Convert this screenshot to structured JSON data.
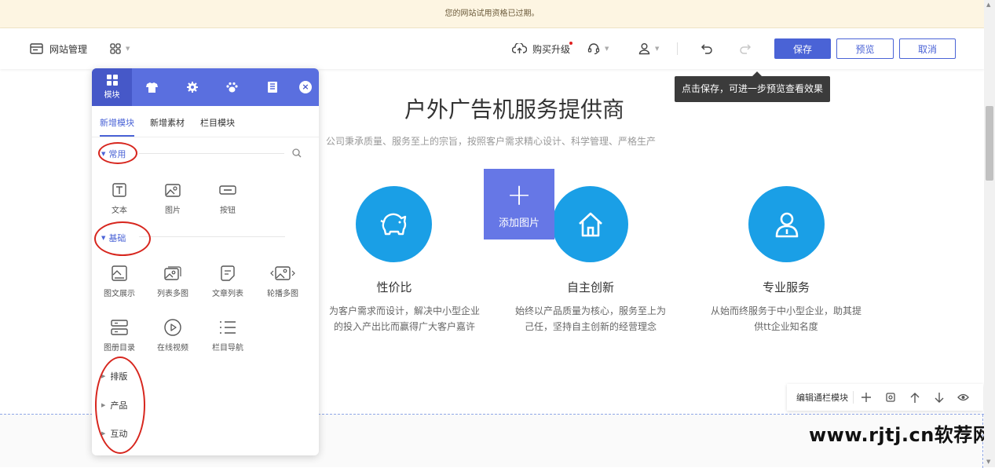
{
  "banner": {
    "text": "您的网站试用资格已过期。"
  },
  "topbar": {
    "site_manage": "网站管理",
    "buy_upgrade": "购买升级",
    "save": "保存",
    "preview": "预览",
    "cancel": "取消"
  },
  "tooltip": {
    "text": "点击保存，可进一步预览查看效果"
  },
  "page": {
    "title": "户外广告机服务提供商",
    "subtitle": "公司秉承质量、服务至上的宗旨，按照客户需求精心设计、科学管理、严格生产",
    "add_image": "添加图片",
    "features": [
      {
        "title": "性价比",
        "desc_line1": "为客户需求而设计，解决中小型企业",
        "desc_line2": "的投入产出比而赢得广大客户嘉许",
        "icon": "piggy-bank-icon"
      },
      {
        "title": "自主创新",
        "desc_line1": "始终以产品质量为核心，服务至上为",
        "desc_line2": "己任，坚持自主创新的经营理念",
        "icon": "home-icon"
      },
      {
        "title": "专业服务",
        "desc_line1": "从始而终服务于中小型企业，助其提",
        "desc_line2": "供tt企业知名度",
        "icon": "user-icon"
      }
    ]
  },
  "float_toolbar": {
    "label": "编辑通栏模块"
  },
  "watermark": {
    "text": "www.rjtj.cn软荐网"
  },
  "panel": {
    "head_tab_label": "模块",
    "subtabs": [
      "新增模块",
      "新增素材",
      "栏目模块"
    ],
    "sections": {
      "common": "常用",
      "basic": "基础",
      "layout": "排版",
      "product": "产品",
      "interact": "互动"
    },
    "common_tools": [
      "文本",
      "图片",
      "按钮"
    ],
    "basic_tools": [
      "图文展示",
      "列表多图",
      "文章列表",
      "轮播多图",
      "图册目录",
      "在线视频",
      "栏目导航"
    ]
  },
  "colors": {
    "accent": "#4a63d6",
    "feature_blue": "#1a9fe6",
    "panel_head": "#5a6fdf",
    "annotation_red": "#d7261e"
  }
}
